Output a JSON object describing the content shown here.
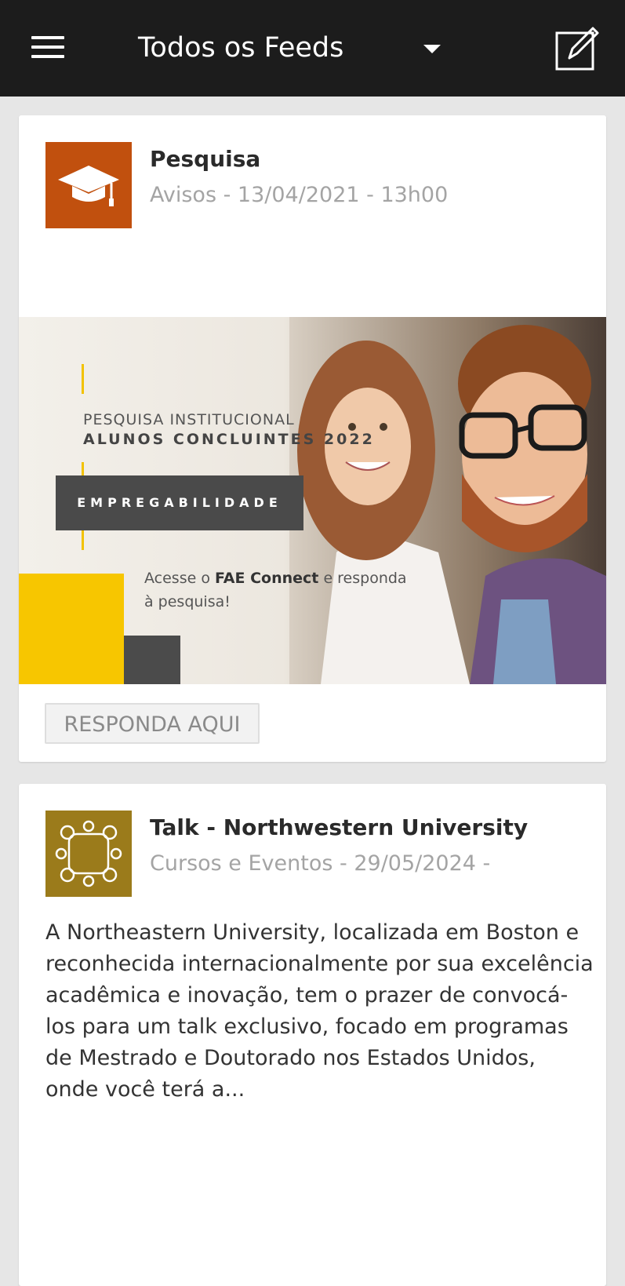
{
  "header": {
    "title": "Todos os Feeds",
    "menu_icon": "hamburger-menu-icon",
    "dropdown_icon": "caret-down-icon",
    "compose_icon": "compose-icon"
  },
  "posts": [
    {
      "title": "Pesquisa",
      "meta": "Avisos - 13/04/2021 - 13h00",
      "icon": "graduation-cap-icon",
      "icon_bg": "#c1500e",
      "banner": {
        "line1": "PESQUISA INSTITUCIONAL",
        "line2": "ALUNOS CONCLUINTES 2022",
        "box_label": "EMPREGABILIDADE",
        "cta_prefix": "Acesse o",
        "cta_brand": "FAE Connect",
        "cta_suffix": "e responda",
        "cta_line2": "à pesquisa!",
        "accent_color": "#f7c600"
      },
      "button_label": "RESPONDA AQUI"
    },
    {
      "title": "Talk - Northwestern University",
      "meta": "Cursos e Eventos - 29/05/2024 -",
      "icon": "events-network-icon",
      "icon_bg": "#9b7b1b",
      "body": "A Northeastern University, localizada em Boston e reconhecida internacionalmente por sua excelência acadêmica e inovação, tem o prazer de convocá-los para um talk exclusivo, focado em programas de Mestrado e Doutorado nos Estados Unidos, onde você terá a..."
    }
  ]
}
